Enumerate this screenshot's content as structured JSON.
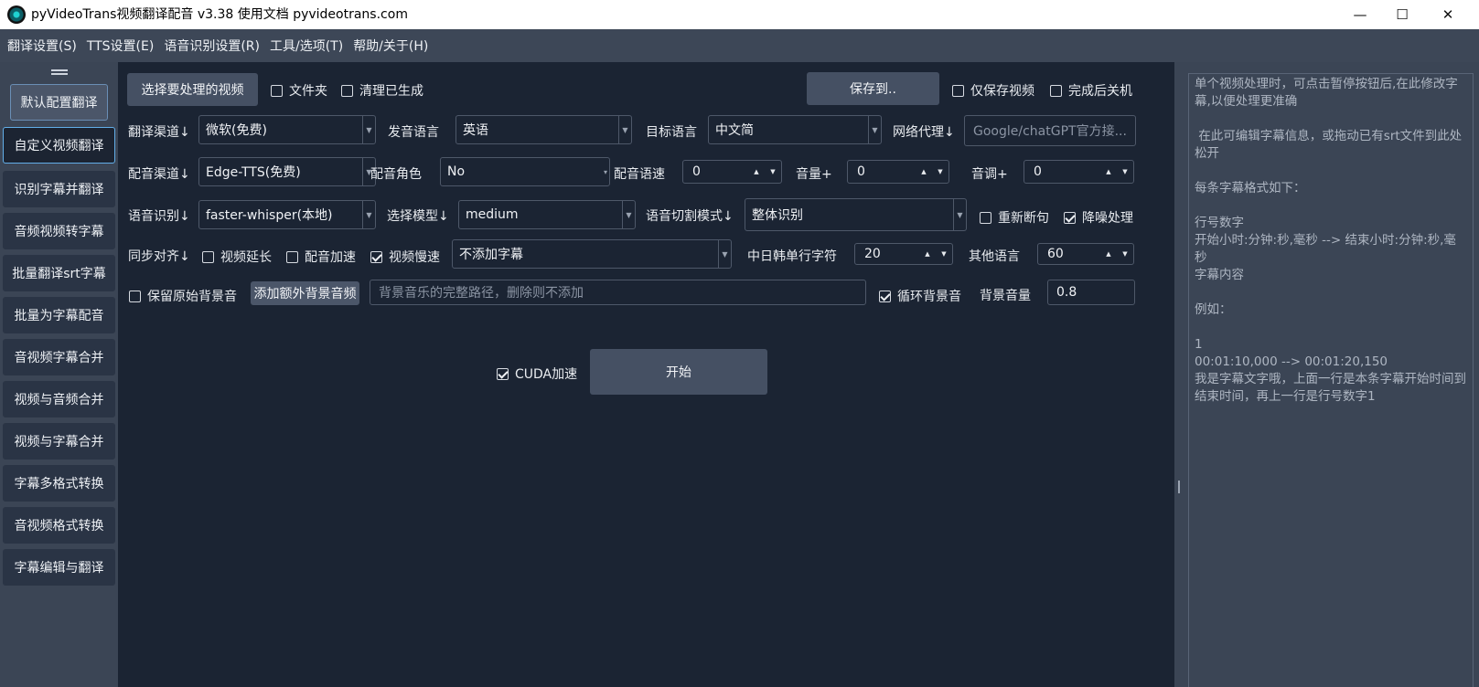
{
  "window": {
    "title": "pyVideoTrans视频翻译配音 v3.38  使用文档  pyvideotrans.com",
    "minimize": "—",
    "maximize": "☐",
    "close": "✕"
  },
  "menu": [
    "翻译设置(S)",
    "TTS设置(E)",
    "语音识别设置(R)",
    "工具/选项(T)",
    "帮助/关于(H)"
  ],
  "sidebar": {
    "items": [
      "默认配置翻译",
      "自定义视频翻译",
      "识别字幕并翻译",
      "音频视频转字幕",
      "批量翻译srt字幕",
      "批量为字幕配音",
      "音视频字幕合并",
      "视频与音频合并",
      "视频与字幕合并",
      "字幕多格式转换",
      "音视频格式转换",
      "字幕编辑与翻译"
    ]
  },
  "row1": {
    "select_video": "选择要处理的视频",
    "folder": "文件夹",
    "folder_checked": false,
    "clean": "清理已生成",
    "clean_checked": false,
    "save_to": "保存到..",
    "only_video": "仅保存视频",
    "only_video_checked": false,
    "shutdown": "完成后关机",
    "shutdown_checked": false
  },
  "row2": {
    "trans_channel_label": "翻译渠道↓",
    "trans_channel": "微软(免费)",
    "source_lang_label": "发音语言",
    "source_lang": "英语",
    "target_lang_label": "目标语言",
    "target_lang": "中文简",
    "proxy_label": "网络代理↓",
    "proxy_placeholder": "Google/chatGPT官方接..."
  },
  "row3": {
    "tts_label": "配音渠道↓",
    "tts": "Edge-TTS(免费)",
    "role_label": "配音角色",
    "role": "No",
    "rate_label": "配音语速",
    "rate": "0",
    "volume_label": "音量+",
    "volume": "0",
    "pitch_label": "音调+",
    "pitch": "0"
  },
  "row4": {
    "asr_label": "语音识别↓",
    "asr": "faster-whisper(本地)",
    "model_label": "选择模型↓",
    "model": "medium",
    "split_label": "语音切割模式↓",
    "split": "整体识别",
    "rebreak": "重新断句",
    "rebreak_checked": false,
    "denoise": "降噪处理",
    "denoise_checked": true
  },
  "row5": {
    "sync_label": "同步对齐↓",
    "video_extend": "视频延长",
    "video_extend_checked": false,
    "dub_speedup": "配音加速",
    "dub_speedup_checked": false,
    "video_slow": "视频慢速",
    "video_slow_checked": true,
    "subtitle_mode": "不添加字幕",
    "cjk_chars_label": "中日韩单行字符",
    "cjk_chars": "20",
    "other_chars_label": "其他语言",
    "other_chars": "60"
  },
  "row6": {
    "keep_bgm": "保留原始背景音",
    "keep_bgm_checked": false,
    "add_bgm": "添加额外背景音频",
    "bgm_path_placeholder": "背景音乐的完整路径，删除则不添加",
    "loop_bgm": "循环背景音",
    "loop_bgm_checked": true,
    "bgm_volume_label": "背景音量",
    "bgm_volume": "0.8"
  },
  "actions": {
    "cuda": "CUDA加速",
    "cuda_checked": true,
    "start": "开始"
  },
  "hint_text": "单个视频处理时，可点击暂停按钮后,在此修改字幕,以便处理更准确\n\n 在此可编辑字幕信息，或拖动已有srt文件到此处松开\n\n每条字幕格式如下：\n\n行号数字\n开始小时:分钟:秒,毫秒 --> 结束小时:分钟:秒,毫秒\n字幕内容\n\n例如：\n\n1\n00:01:10,000 --> 00:01:20,150\n我是字幕文字哦，上面一行是本条字幕开始时间到结束时间，再上一行是行号数字1"
}
